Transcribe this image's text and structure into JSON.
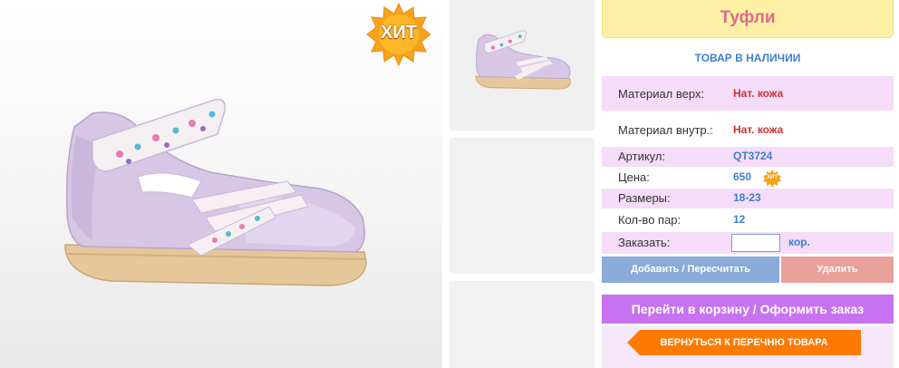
{
  "badge": {
    "text": "ХИТ",
    "small_text": "ХИТ"
  },
  "product": {
    "title": "Туфли",
    "stock_status": "ТОВАР В НАЛИЧИИ",
    "specs": [
      {
        "label": "Материал верх:",
        "value": "Нат. кожа"
      },
      {
        "label": "Материал внутр.:",
        "value": "Нат. кожа"
      },
      {
        "label": "Артикул:",
        "value": "QT3724"
      },
      {
        "label": "Цена:",
        "value": "650"
      },
      {
        "label": "Размеры:",
        "value": "18-23"
      },
      {
        "label": "Кол-во пар:",
        "value": "12"
      }
    ],
    "order": {
      "label": "Заказать:",
      "value": "",
      "unit": "кор."
    }
  },
  "buttons": {
    "add": "Добавить / Пересчитать",
    "delete": "Удалить",
    "cart": "Перейти в корзину / Оформить заказ",
    "back": "ВЕРНУТЬСЯ К ПЕРЕЧНЮ ТОВАРА"
  },
  "colors": {
    "title_bg": "#fdf0a4",
    "title_text": "#dd6a8c",
    "row_pink": "#f5dcf8",
    "value_red": "#cc3333",
    "value_blue": "#3d7fd0",
    "add_button": "#8aaad8",
    "delete_button": "#e9a09a",
    "cart_button": "#c772f0",
    "back_button": "#ff7a00",
    "badge": "#f7a21a"
  }
}
